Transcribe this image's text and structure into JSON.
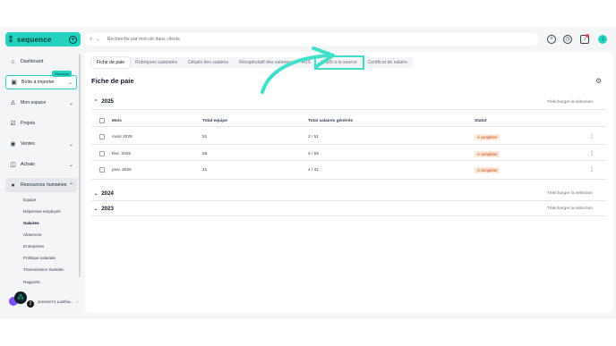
{
  "brand": {
    "name": "sequence"
  },
  "sidebar": {
    "items": [
      {
        "label": "Dashboard"
      },
      {
        "label": "Boîte à importer",
        "badge": "Nouveau"
      },
      {
        "label": "Mon espace"
      },
      {
        "label": "Projets"
      },
      {
        "label": "Ventes"
      },
      {
        "label": "Achats"
      },
      {
        "label": "Ressources humaines"
      }
    ],
    "sub_items": [
      "Equipe",
      "Dépenses employés",
      "Salaires",
      "Absences",
      "Entreprises",
      "Politique salariale",
      "Transmission Swisdec",
      "Rapports"
    ],
    "user": "Jones4Y1 Lasthia..."
  },
  "header": {
    "search_placeholder": "Recherche par mot-clé dans clients",
    "avatar_initials": "J"
  },
  "tabs": [
    "Fiche de paie",
    "Rubriques salariales",
    "Détails des salaires",
    "Récapitulatif des salaires",
    "AVS",
    "Impôt à la source",
    "Certificat de salaire"
  ],
  "page_title": "Fiche de paie",
  "download_label": "Télécharger la sélection",
  "table": {
    "columns": [
      "Mois",
      "Total equipe",
      "Total salaires générés",
      "Statut"
    ],
    "rows": [
      {
        "month": "mars 2025",
        "team": "51",
        "generated": "2 / 51",
        "status": "À compléter"
      },
      {
        "month": "févr. 2025",
        "team": "55",
        "generated": "4 / 55",
        "status": "À compléter"
      },
      {
        "month": "janv. 2025",
        "team": "41",
        "generated": "4 / 41",
        "status": "À compléter"
      }
    ]
  },
  "years": [
    "2025",
    "2024",
    "2023"
  ],
  "colors": {
    "accent": "#23d3c0",
    "highlight": "#3fe0c8",
    "status_text": "#c2410c",
    "status_bg": "#fde8d8"
  }
}
